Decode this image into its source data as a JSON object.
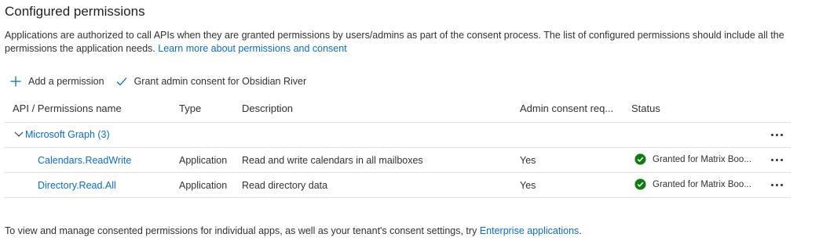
{
  "section": {
    "title": "Configured permissions",
    "description": "Applications are authorized to call APIs when they are granted permissions by users/admins as part of the consent process. The list of configured permissions should include all the permissions the application needs.",
    "learn_more_link": "Learn more about permissions and consent"
  },
  "toolbar": {
    "add_permission_label": "Add a permission",
    "grant_consent_label": "Grant admin consent for Obsidian River"
  },
  "table": {
    "columns": {
      "name": "API / Permissions name",
      "type": "Type",
      "description": "Description",
      "admin_consent": "Admin consent req...",
      "status": "Status"
    },
    "group": {
      "label": "Microsoft Graph (3)"
    },
    "rows": [
      {
        "name": "Calendars.ReadWrite",
        "type": "Application",
        "description": "Read and write calendars in all mailboxes",
        "admin_consent": "Yes",
        "status": "Granted for Matrix Boo..."
      },
      {
        "name": "Directory.Read.All",
        "type": "Application",
        "description": "Read directory data",
        "admin_consent": "Yes",
        "status": "Granted for Matrix Boo..."
      }
    ]
  },
  "footer": {
    "text": "To view and manage consented permissions for individual apps, as well as your tenant's consent settings, try",
    "link": "Enterprise applications",
    "suffix": "."
  },
  "colors": {
    "link": "#0f6cbd",
    "success": "#107c10",
    "divider": "#e1dfdd"
  },
  "icons": {
    "add": "plus-icon",
    "grant": "checkmark-icon",
    "expand": "chevron-down-icon",
    "status": "check-circle-icon",
    "more": "more-ellipsis-icon"
  }
}
